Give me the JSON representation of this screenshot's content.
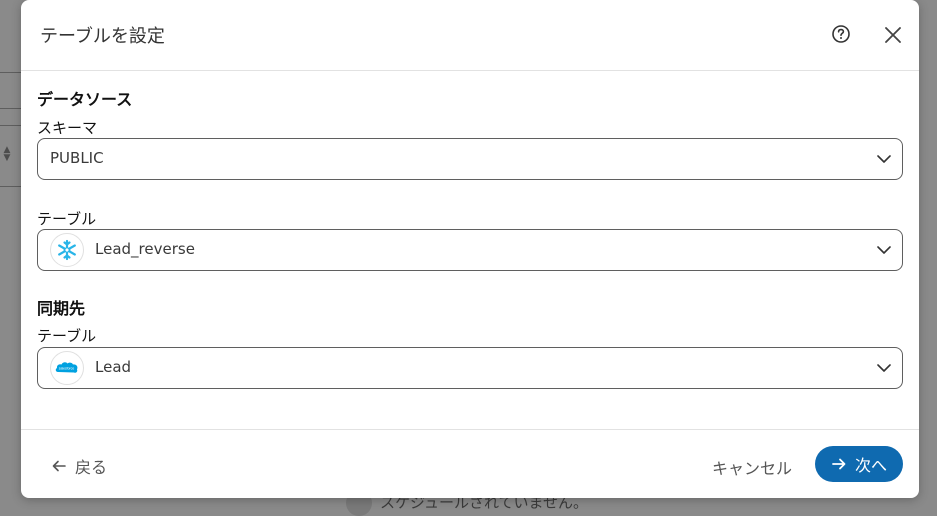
{
  "background": {
    "bottom_text": "スケジュールされていません。"
  },
  "dialog": {
    "title": "テーブルを設定",
    "help_icon": "help-circle-icon",
    "close_icon": "close-icon"
  },
  "source": {
    "section_title": "データソース",
    "schema_label": "スキーマ",
    "schema_value": "PUBLIC",
    "table_label": "テーブル",
    "table_value": "Lead_reverse",
    "table_icon": "snowflake-icon"
  },
  "destination": {
    "section_title": "同期先",
    "table_label": "テーブル",
    "table_value": "Lead",
    "table_icon": "salesforce-cloud-icon",
    "logo_text": "salesforce"
  },
  "footer": {
    "back_label": "戻る",
    "cancel_label": "キャンセル",
    "next_label": "次へ"
  },
  "colors": {
    "primary": "#0f6ab0",
    "snowflake": "#29b5e8",
    "salesforce": "#00a1e0"
  }
}
